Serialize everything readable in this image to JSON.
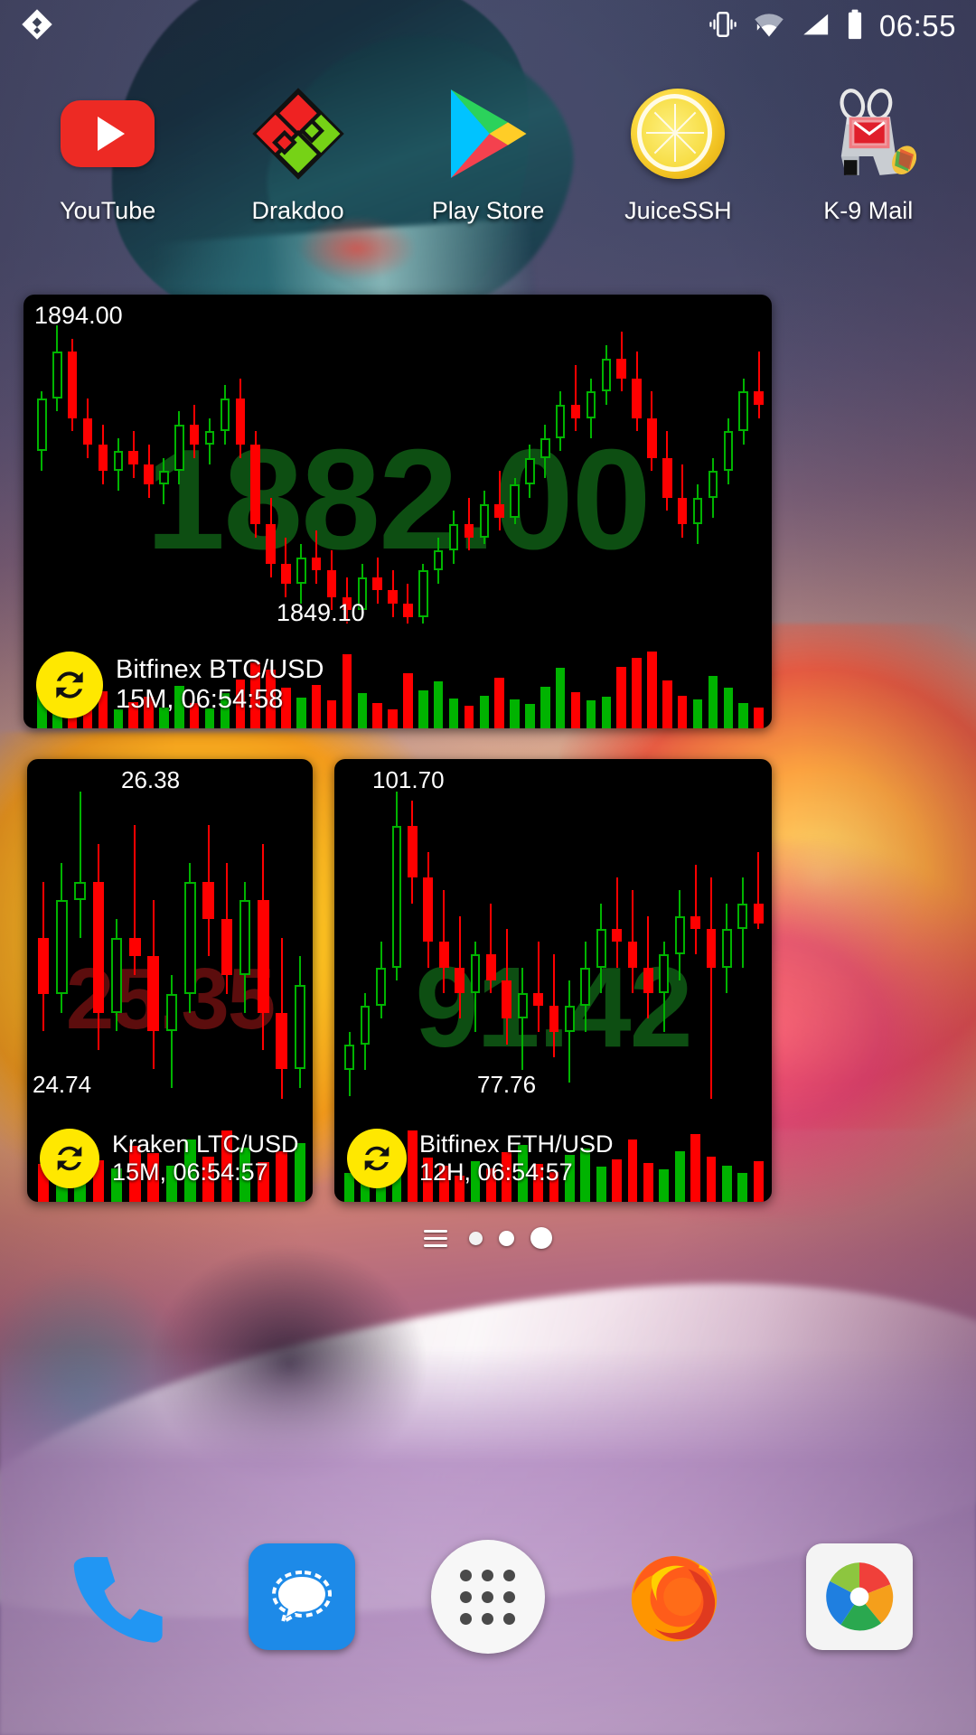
{
  "statusbar": {
    "time": "06:55",
    "icons": [
      "vibrate-icon",
      "wifi-icon",
      "cellular-signal-icon",
      "battery-icon"
    ],
    "notification_icon": "drakdoo-notification-icon"
  },
  "apps": [
    {
      "label": "YouTube",
      "icon": "youtube-icon"
    },
    {
      "label": "Drakdoo",
      "icon": "drakdoo-icon"
    },
    {
      "label": "Play Store",
      "icon": "play-store-icon"
    },
    {
      "label": "JuiceSSH",
      "icon": "juicessh-lemon-icon"
    },
    {
      "label": "K-9 Mail",
      "icon": "k9-mail-icon"
    }
  ],
  "widgets": [
    {
      "id": "btc",
      "high": "1894.00",
      "low": "1849.10",
      "price": "1882.00",
      "direction": "up",
      "pair": "Bitfinex BTC/USD",
      "meta": "15M, 06:54:58",
      "refresh_icon": "refresh-icon"
    },
    {
      "id": "ltc",
      "high": "26.38",
      "low": "24.74",
      "price": "25.35",
      "direction": "down",
      "pair": "Kraken LTC/USD",
      "meta": "15M, 06:54:57",
      "refresh_icon": "refresh-icon"
    },
    {
      "id": "eth",
      "high": "101.70",
      "low": "77.76",
      "price": "91.42",
      "direction": "up",
      "pair": "Bitfinex ETH/USD",
      "meta": "12H, 06:54:57",
      "refresh_icon": "refresh-icon"
    }
  ],
  "page_indicator": {
    "pages": 3,
    "active_index": 2,
    "menu_icon": "page-menu-icon"
  },
  "dock": [
    {
      "label": "Phone",
      "icon": "phone-icon"
    },
    {
      "label": "Messaging",
      "icon": "messaging-icon"
    },
    {
      "label": "All Apps",
      "icon": "app-drawer-icon"
    },
    {
      "label": "Firefox",
      "icon": "firefox-icon"
    },
    {
      "label": "Gallery",
      "icon": "gallery-icon"
    }
  ],
  "colors": {
    "bull": "#00b300",
    "bear": "#ff0000",
    "accent_yellow": "#ffe800",
    "widget_bg": "#000000",
    "text": "#ffffff"
  },
  "chart_data": [
    {
      "type": "candlestick",
      "id": "btc",
      "title": "Bitfinex BTC/USD",
      "timeframe": "15M",
      "timestamp": "06:54:58",
      "ylim": [
        1849.1,
        1894.0
      ],
      "last_price": 1882.0,
      "ohlc": [
        [
          1875,
          1884,
          1872,
          1883
        ],
        [
          1883,
          1894,
          1881,
          1890
        ],
        [
          1890,
          1892,
          1878,
          1880
        ],
        [
          1880,
          1883,
          1874,
          1876
        ],
        [
          1876,
          1879,
          1870,
          1872
        ],
        [
          1872,
          1877,
          1869,
          1875
        ],
        [
          1875,
          1878,
          1871,
          1873
        ],
        [
          1873,
          1876,
          1868,
          1870
        ],
        [
          1870,
          1874,
          1867,
          1872
        ],
        [
          1872,
          1881,
          1870,
          1879
        ],
        [
          1879,
          1882,
          1874,
          1876
        ],
        [
          1876,
          1880,
          1873,
          1878
        ],
        [
          1878,
          1885,
          1876,
          1883
        ],
        [
          1883,
          1886,
          1874,
          1876
        ],
        [
          1876,
          1878,
          1862,
          1864
        ],
        [
          1864,
          1868,
          1856,
          1858
        ],
        [
          1858,
          1862,
          1853,
          1855
        ],
        [
          1855,
          1861,
          1852,
          1859
        ],
        [
          1859,
          1863,
          1855,
          1857
        ],
        [
          1857,
          1860,
          1851,
          1853
        ],
        [
          1853,
          1856,
          1849,
          1851
        ],
        [
          1851,
          1858,
          1850,
          1856
        ],
        [
          1856,
          1859,
          1852,
          1854
        ],
        [
          1854,
          1857,
          1850,
          1852
        ],
        [
          1852,
          1855,
          1849,
          1850
        ],
        [
          1850,
          1858,
          1849,
          1857
        ],
        [
          1857,
          1862,
          1855,
          1860
        ],
        [
          1860,
          1866,
          1858,
          1864
        ],
        [
          1864,
          1868,
          1860,
          1862
        ],
        [
          1862,
          1869,
          1861,
          1867
        ],
        [
          1867,
          1872,
          1863,
          1865
        ],
        [
          1865,
          1871,
          1864,
          1870
        ],
        [
          1870,
          1876,
          1868,
          1874
        ],
        [
          1874,
          1879,
          1871,
          1877
        ],
        [
          1877,
          1884,
          1875,
          1882
        ],
        [
          1882,
          1888,
          1878,
          1880
        ],
        [
          1880,
          1886,
          1877,
          1884
        ],
        [
          1884,
          1891,
          1882,
          1889
        ],
        [
          1889,
          1893,
          1884,
          1886
        ],
        [
          1886,
          1890,
          1878,
          1880
        ],
        [
          1880,
          1884,
          1872,
          1874
        ],
        [
          1874,
          1878,
          1866,
          1868
        ],
        [
          1868,
          1873,
          1862,
          1864
        ],
        [
          1864,
          1870,
          1861,
          1868
        ],
        [
          1868,
          1874,
          1865,
          1872
        ],
        [
          1872,
          1880,
          1870,
          1878
        ],
        [
          1878,
          1886,
          1876,
          1884
        ],
        [
          1884,
          1890,
          1880,
          1882
        ]
      ],
      "volume": [
        32,
        44,
        28,
        22,
        35,
        18,
        25,
        30,
        20,
        40,
        24,
        19,
        33,
        46,
        62,
        55,
        38,
        29,
        41,
        26,
        70,
        33,
        24,
        18,
        52,
        36,
        44,
        28,
        21,
        31,
        48,
        27,
        23,
        39,
        57,
        34,
        26,
        30,
        58,
        66,
        72,
        45,
        31,
        27,
        49,
        38,
        24,
        20
      ]
    },
    {
      "type": "candlestick",
      "id": "ltc",
      "title": "Kraken LTC/USD",
      "timeframe": "15M",
      "timestamp": "06:54:57",
      "ylim": [
        24.74,
        26.38
      ],
      "last_price": 25.35,
      "ohlc": [
        [
          25.6,
          25.9,
          25.1,
          25.3
        ],
        [
          25.3,
          26.0,
          25.2,
          25.8
        ],
        [
          25.8,
          26.38,
          25.6,
          25.9
        ],
        [
          25.9,
          26.1,
          25.0,
          25.2
        ],
        [
          25.2,
          25.7,
          25.1,
          25.6
        ],
        [
          25.6,
          26.2,
          25.4,
          25.5
        ],
        [
          25.5,
          25.8,
          24.9,
          25.1
        ],
        [
          25.1,
          25.4,
          24.8,
          25.3
        ],
        [
          25.3,
          26.0,
          25.2,
          25.9
        ],
        [
          25.9,
          26.2,
          25.5,
          25.7
        ],
        [
          25.7,
          26.0,
          25.3,
          25.4
        ],
        [
          25.4,
          25.9,
          25.2,
          25.8
        ],
        [
          25.8,
          26.1,
          25.0,
          25.2
        ],
        [
          25.2,
          25.6,
          24.74,
          24.9
        ],
        [
          24.9,
          25.5,
          24.8,
          25.35
        ]
      ],
      "volume": [
        20,
        28,
        35,
        22,
        18,
        30,
        26,
        19,
        33,
        24,
        38,
        29,
        21,
        27,
        31
      ]
    },
    {
      "type": "candlestick",
      "id": "eth",
      "title": "Bitfinex ETH/USD",
      "timeframe": "12H",
      "timestamp": "06:54:57",
      "ylim": [
        77.76,
        101.7
      ],
      "last_price": 91.42,
      "ohlc": [
        [
          80,
          83,
          78,
          82
        ],
        [
          82,
          86,
          80,
          85
        ],
        [
          85,
          90,
          84,
          88
        ],
        [
          88,
          101.7,
          87,
          99
        ],
        [
          99,
          101,
          93,
          95
        ],
        [
          95,
          97,
          88,
          90
        ],
        [
          90,
          94,
          86,
          88
        ],
        [
          88,
          92,
          84,
          86
        ],
        [
          86,
          90,
          83,
          89
        ],
        [
          89,
          93,
          86,
          87
        ],
        [
          87,
          91,
          82,
          84
        ],
        [
          84,
          88,
          80,
          86
        ],
        [
          86,
          90,
          83,
          85
        ],
        [
          85,
          89,
          81,
          83
        ],
        [
          83,
          87,
          79,
          85
        ],
        [
          85,
          90,
          83,
          88
        ],
        [
          88,
          93,
          86,
          91
        ],
        [
          91,
          95,
          88,
          90
        ],
        [
          90,
          94,
          86,
          88
        ],
        [
          88,
          92,
          84,
          86
        ],
        [
          86,
          90,
          83,
          89
        ],
        [
          89,
          94,
          87,
          92
        ],
        [
          92,
          96,
          89,
          91
        ],
        [
          91,
          95,
          77.76,
          88
        ],
        [
          88,
          93,
          86,
          91
        ],
        [
          91,
          95,
          88,
          93
        ],
        [
          93,
          97,
          91,
          91.42
        ]
      ],
      "volume": [
        22,
        30,
        25,
        40,
        55,
        34,
        28,
        20,
        31,
        26,
        38,
        44,
        29,
        23,
        36,
        41,
        27,
        33,
        48,
        30,
        25,
        39,
        52,
        35,
        28,
        22,
        31
      ]
    }
  ]
}
